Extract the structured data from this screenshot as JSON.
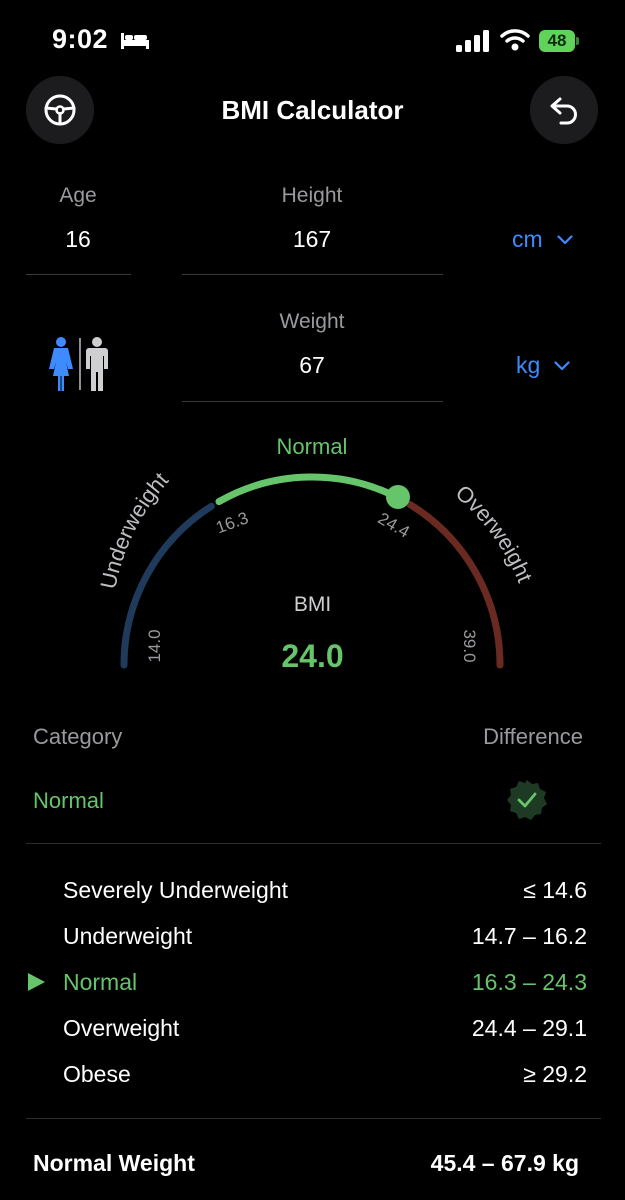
{
  "status_bar": {
    "time": "9:02",
    "battery": "48"
  },
  "header": {
    "title": "BMI Calculator"
  },
  "inputs": {
    "age": {
      "label": "Age",
      "value": "16"
    },
    "height": {
      "label": "Height",
      "value": "167",
      "unit": "cm"
    },
    "weight": {
      "label": "Weight",
      "value": "67",
      "unit": "kg"
    }
  },
  "gauge": {
    "bmi_label": "BMI",
    "bmi_value": "24.0",
    "segments": {
      "underweight": "Underweight",
      "normal": "Normal",
      "overweight": "Overweight"
    },
    "ticks": {
      "min": "14.0",
      "low": "16.3",
      "high": "24.4",
      "max": "39.0"
    },
    "colors": {
      "underweight": "#1f3a5a",
      "normal": "#66c46a",
      "overweight": "#6a2a22"
    }
  },
  "category": {
    "heading": "Category",
    "difference_heading": "Difference",
    "value": "Normal"
  },
  "ranges": [
    {
      "name": "Severely Underweight",
      "value": "≤ 14.6",
      "active": false
    },
    {
      "name": "Underweight",
      "value": "14.7 – 16.2",
      "active": false
    },
    {
      "name": "Normal",
      "value": "16.3 – 24.3",
      "active": true
    },
    {
      "name": "Overweight",
      "value": "24.4 – 29.1",
      "active": false
    },
    {
      "name": "Obese",
      "value": "≥ 29.2",
      "active": false
    }
  ],
  "normal_weight": {
    "label": "Normal Weight",
    "value": "45.4 – 67.9 kg"
  }
}
